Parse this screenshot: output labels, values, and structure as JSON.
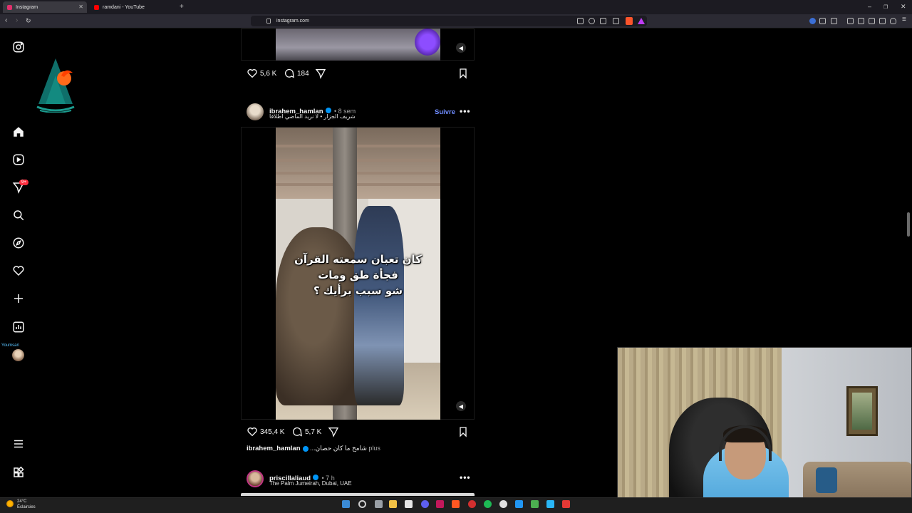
{
  "browser": {
    "tabs": [
      {
        "title": "Instagram",
        "active": true,
        "favicon_color": "#e1306c"
      },
      {
        "title": "ramdani - YouTube",
        "active": false,
        "favicon_color": "#ff0000"
      }
    ],
    "new_tab": "+",
    "url": "instagram.com",
    "window_controls": {
      "minimize": "–",
      "restore": "❐",
      "close": "✕"
    }
  },
  "sidebar": {
    "icons": [
      "instagram-icon",
      "home-icon",
      "reels-icon",
      "messages-icon",
      "search-icon",
      "explore-icon",
      "notifications-icon",
      "create-icon",
      "dashboard-icon"
    ],
    "messages_badge": "9+",
    "user_label": "Youmsari",
    "bottom_icons": [
      "menu-icon",
      "more-apps-icon"
    ]
  },
  "feed": {
    "top_post": {
      "likes": "5,6 K",
      "comments": "184"
    },
    "post": {
      "username": "ibrahem_hamlan",
      "verified": true,
      "time": "• 8 sem",
      "audio": "شريف الجزار • لا نريد الماضي اطلاقا",
      "follow_label": "Suivre",
      "video_caption": [
        "كان تعبان سمعته القرآن",
        "فجأة طق ومات",
        "شو سبب برأيك ؟"
      ],
      "likes": "345,4 K",
      "comments": "5,7 K",
      "caption_user": "ibrahem_hamlan",
      "caption_text": "...شامخ ما كان حصان",
      "caption_more": "plus"
    },
    "next_post": {
      "username": "priscillaliaud",
      "verified": true,
      "time": "• 7 h",
      "location": "The Palm Jumeirah, Dubai, UAE"
    }
  },
  "taskbar": {
    "temperature": "24°C",
    "weather": "Éclaircies",
    "app_colors": [
      "#3b8bd6",
      "#9aa0a6",
      "#e6e6e6",
      "#f3c246",
      "#5d5fef",
      "#c2185b",
      "#ff5722",
      "#d32f2f",
      "#1db954",
      "#e0e0e0",
      "#2196f3",
      "#4caf50",
      "#29b6f6",
      "#e53935"
    ]
  },
  "colors": {
    "accent_link": "#6f8cff",
    "verified": "#0095f6",
    "badge": "#ff3040"
  }
}
